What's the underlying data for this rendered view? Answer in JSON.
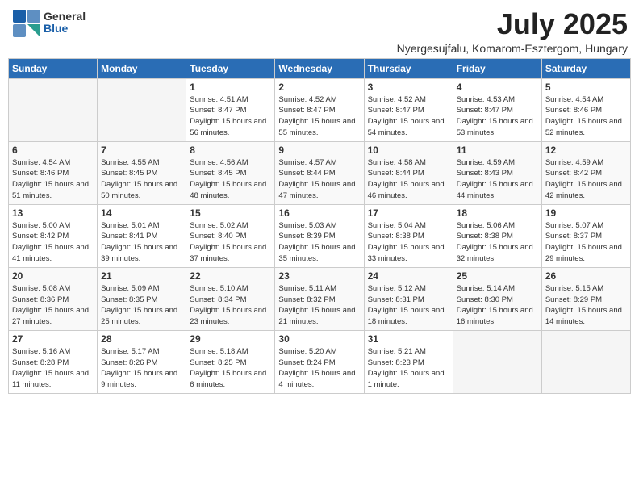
{
  "header": {
    "logo_general": "General",
    "logo_blue": "Blue",
    "month_year": "July 2025",
    "location": "Nyergesujfalu, Komarom-Esztergom, Hungary"
  },
  "days_of_week": [
    "Sunday",
    "Monday",
    "Tuesday",
    "Wednesday",
    "Thursday",
    "Friday",
    "Saturday"
  ],
  "weeks": [
    [
      {
        "day": "",
        "empty": true
      },
      {
        "day": "",
        "empty": true
      },
      {
        "day": "1",
        "sunrise": "Sunrise: 4:51 AM",
        "sunset": "Sunset: 8:47 PM",
        "daylight": "Daylight: 15 hours and 56 minutes."
      },
      {
        "day": "2",
        "sunrise": "Sunrise: 4:52 AM",
        "sunset": "Sunset: 8:47 PM",
        "daylight": "Daylight: 15 hours and 55 minutes."
      },
      {
        "day": "3",
        "sunrise": "Sunrise: 4:52 AM",
        "sunset": "Sunset: 8:47 PM",
        "daylight": "Daylight: 15 hours and 54 minutes."
      },
      {
        "day": "4",
        "sunrise": "Sunrise: 4:53 AM",
        "sunset": "Sunset: 8:47 PM",
        "daylight": "Daylight: 15 hours and 53 minutes."
      },
      {
        "day": "5",
        "sunrise": "Sunrise: 4:54 AM",
        "sunset": "Sunset: 8:46 PM",
        "daylight": "Daylight: 15 hours and 52 minutes."
      }
    ],
    [
      {
        "day": "6",
        "sunrise": "Sunrise: 4:54 AM",
        "sunset": "Sunset: 8:46 PM",
        "daylight": "Daylight: 15 hours and 51 minutes."
      },
      {
        "day": "7",
        "sunrise": "Sunrise: 4:55 AM",
        "sunset": "Sunset: 8:45 PM",
        "daylight": "Daylight: 15 hours and 50 minutes."
      },
      {
        "day": "8",
        "sunrise": "Sunrise: 4:56 AM",
        "sunset": "Sunset: 8:45 PM",
        "daylight": "Daylight: 15 hours and 48 minutes."
      },
      {
        "day": "9",
        "sunrise": "Sunrise: 4:57 AM",
        "sunset": "Sunset: 8:44 PM",
        "daylight": "Daylight: 15 hours and 47 minutes."
      },
      {
        "day": "10",
        "sunrise": "Sunrise: 4:58 AM",
        "sunset": "Sunset: 8:44 PM",
        "daylight": "Daylight: 15 hours and 46 minutes."
      },
      {
        "day": "11",
        "sunrise": "Sunrise: 4:59 AM",
        "sunset": "Sunset: 8:43 PM",
        "daylight": "Daylight: 15 hours and 44 minutes."
      },
      {
        "day": "12",
        "sunrise": "Sunrise: 4:59 AM",
        "sunset": "Sunset: 8:42 PM",
        "daylight": "Daylight: 15 hours and 42 minutes."
      }
    ],
    [
      {
        "day": "13",
        "sunrise": "Sunrise: 5:00 AM",
        "sunset": "Sunset: 8:42 PM",
        "daylight": "Daylight: 15 hours and 41 minutes."
      },
      {
        "day": "14",
        "sunrise": "Sunrise: 5:01 AM",
        "sunset": "Sunset: 8:41 PM",
        "daylight": "Daylight: 15 hours and 39 minutes."
      },
      {
        "day": "15",
        "sunrise": "Sunrise: 5:02 AM",
        "sunset": "Sunset: 8:40 PM",
        "daylight": "Daylight: 15 hours and 37 minutes."
      },
      {
        "day": "16",
        "sunrise": "Sunrise: 5:03 AM",
        "sunset": "Sunset: 8:39 PM",
        "daylight": "Daylight: 15 hours and 35 minutes."
      },
      {
        "day": "17",
        "sunrise": "Sunrise: 5:04 AM",
        "sunset": "Sunset: 8:38 PM",
        "daylight": "Daylight: 15 hours and 33 minutes."
      },
      {
        "day": "18",
        "sunrise": "Sunrise: 5:06 AM",
        "sunset": "Sunset: 8:38 PM",
        "daylight": "Daylight: 15 hours and 32 minutes."
      },
      {
        "day": "19",
        "sunrise": "Sunrise: 5:07 AM",
        "sunset": "Sunset: 8:37 PM",
        "daylight": "Daylight: 15 hours and 29 minutes."
      }
    ],
    [
      {
        "day": "20",
        "sunrise": "Sunrise: 5:08 AM",
        "sunset": "Sunset: 8:36 PM",
        "daylight": "Daylight: 15 hours and 27 minutes."
      },
      {
        "day": "21",
        "sunrise": "Sunrise: 5:09 AM",
        "sunset": "Sunset: 8:35 PM",
        "daylight": "Daylight: 15 hours and 25 minutes."
      },
      {
        "day": "22",
        "sunrise": "Sunrise: 5:10 AM",
        "sunset": "Sunset: 8:34 PM",
        "daylight": "Daylight: 15 hours and 23 minutes."
      },
      {
        "day": "23",
        "sunrise": "Sunrise: 5:11 AM",
        "sunset": "Sunset: 8:32 PM",
        "daylight": "Daylight: 15 hours and 21 minutes."
      },
      {
        "day": "24",
        "sunrise": "Sunrise: 5:12 AM",
        "sunset": "Sunset: 8:31 PM",
        "daylight": "Daylight: 15 hours and 18 minutes."
      },
      {
        "day": "25",
        "sunrise": "Sunrise: 5:14 AM",
        "sunset": "Sunset: 8:30 PM",
        "daylight": "Daylight: 15 hours and 16 minutes."
      },
      {
        "day": "26",
        "sunrise": "Sunrise: 5:15 AM",
        "sunset": "Sunset: 8:29 PM",
        "daylight": "Daylight: 15 hours and 14 minutes."
      }
    ],
    [
      {
        "day": "27",
        "sunrise": "Sunrise: 5:16 AM",
        "sunset": "Sunset: 8:28 PM",
        "daylight": "Daylight: 15 hours and 11 minutes."
      },
      {
        "day": "28",
        "sunrise": "Sunrise: 5:17 AM",
        "sunset": "Sunset: 8:26 PM",
        "daylight": "Daylight: 15 hours and 9 minutes."
      },
      {
        "day": "29",
        "sunrise": "Sunrise: 5:18 AM",
        "sunset": "Sunset: 8:25 PM",
        "daylight": "Daylight: 15 hours and 6 minutes."
      },
      {
        "day": "30",
        "sunrise": "Sunrise: 5:20 AM",
        "sunset": "Sunset: 8:24 PM",
        "daylight": "Daylight: 15 hours and 4 minutes."
      },
      {
        "day": "31",
        "sunrise": "Sunrise: 5:21 AM",
        "sunset": "Sunset: 8:23 PM",
        "daylight": "Daylight: 15 hours and 1 minute."
      },
      {
        "day": "",
        "empty": true
      },
      {
        "day": "",
        "empty": true
      }
    ]
  ]
}
